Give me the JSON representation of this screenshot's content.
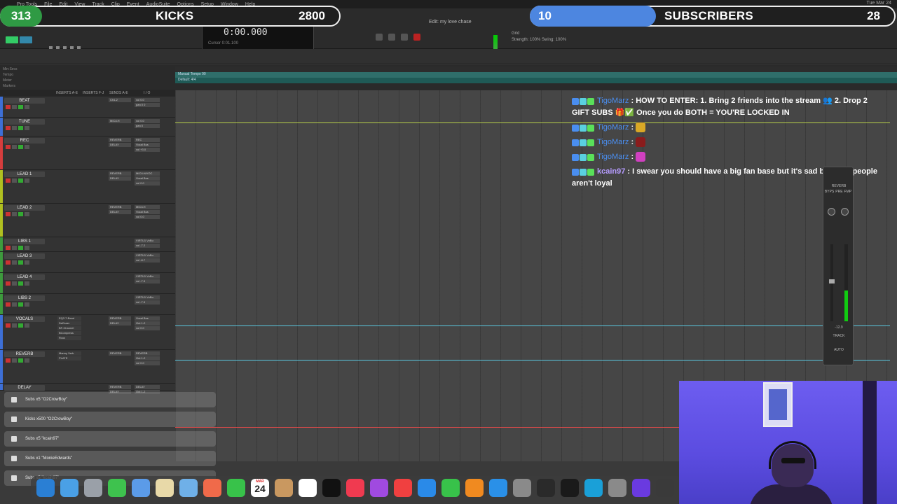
{
  "menubar": {
    "items": [
      "Pro Tools",
      "File",
      "Edit",
      "View",
      "Track",
      "Clip",
      "Event",
      "AudioSuite",
      "Options",
      "Setup",
      "Window",
      "Help"
    ],
    "clock": "Tue Mar 24"
  },
  "toolbar": {
    "counter_main": "0:00.000",
    "counter_sub": "Cursor  0:01.100",
    "edit_window_title": "Edit: my love chase",
    "grid_label": "Grid",
    "strength_label": "Strength: 100%  Swing: 100%"
  },
  "banners": {
    "kicks": {
      "count_left": "313",
      "label": "KICKS",
      "count_right": "2800"
    },
    "subs": {
      "count_left": "10",
      "label": "SUBSCRIBERS",
      "count_right": "28"
    }
  },
  "rulers": {
    "names": [
      "Min:Secs",
      "Tempo",
      "Meter",
      "Markers"
    ],
    "tempo_text": "Manual Tempo  90",
    "meter_text": "Default: 4/4"
  },
  "mix_header": {
    "inserts_ae": "INSERTS A-E",
    "inserts_fj": "INSERTS F-J",
    "sends_ae": "SENDS A-E",
    "io": "I / O"
  },
  "tracks": [
    {
      "name": "BEAT",
      "color": "#3d6fd6",
      "inserts": [
        "Ch1-2"
      ],
      "io": [
        "vol 0.0",
        "pan 0 0"
      ]
    },
    {
      "name": "TUNE",
      "color": "#3d6fd6",
      "inserts": [
        "MIC/LH"
      ],
      "io": [
        "vol 0.0",
        "pan 0"
      ]
    },
    {
      "name": "REC",
      "color": "#d63d3d",
      "inserts": [
        "REVERB",
        "DELAY"
      ],
      "io": [
        "REC",
        "Vocal Bus",
        "vol +3.0"
      ]
    },
    {
      "name": "LEAD 1",
      "color": "#b0c020",
      "inserts": [
        "REVERB",
        "DELAY"
      ],
      "io": [
        "MIC/LH/VOC",
        "Vocal Bus",
        "vol 0.0"
      ]
    },
    {
      "name": "LEAD 2",
      "color": "#b0c020",
      "inserts": [
        "REVERB",
        "DELAY"
      ],
      "io": [
        "MIC/LH",
        "Vocal Bus",
        "vol 0.0"
      ]
    },
    {
      "name": "LIBS 1",
      "color": "#3d9a3d",
      "inserts": [],
      "io": [
        "VIRTU1 VxBu",
        "vol -7.2"
      ]
    },
    {
      "name": "LEAD 3",
      "color": "#3d9a3d",
      "inserts": [],
      "io": [
        "VIRTU1 VxBu",
        "vol -8.7"
      ]
    },
    {
      "name": "LEAD 4",
      "color": "#3d9a3d",
      "inserts": [],
      "io": [
        "VIRTU1 VxBu",
        "vol -7.9"
      ]
    },
    {
      "name": "LIBS 2",
      "color": "#3d9a3d",
      "inserts": [],
      "io": [
        "VIRTU1 VxBu",
        "vol -7.9"
      ]
    },
    {
      "name": "VOCALS",
      "color": "#3d6fd6",
      "inserts": [
        "REVERB",
        "DELAY"
      ],
      "plugins": [
        "EQ3 7-Band",
        "DeEsser",
        "BF-Channel",
        "BCompress",
        "Rvox"
      ],
      "io": [
        "Vocal Bus",
        "Out 1-2",
        "vol 0.0"
      ]
    },
    {
      "name": "REVERB",
      "color": "#3d6fd6",
      "inserts": [
        "REVERB"
      ],
      "plugins": [
        "Manny Verb",
        "PLATE"
      ],
      "io": [
        "REVERB",
        "Out 1-2",
        "vol 0.0"
      ]
    },
    {
      "name": "DELAY",
      "color": "#3d6fd6",
      "inserts": [
        "REVERB",
        "DELAY"
      ],
      "io": [
        "DELAY",
        "Out 1-2"
      ]
    }
  ],
  "chat": [
    {
      "user": "TigoMarz",
      "user_style": "blue",
      "text": "HOW TO ENTER: 1. Bring 2 friends into the stream 👥 2. Drop 2 GIFT SUBS 🎁✅ Once you do BOTH = YOU'RE LOCKED IN",
      "emote": ""
    },
    {
      "user": "TigoMarz",
      "user_style": "blue",
      "text": "",
      "emote": "#d9a826"
    },
    {
      "user": "TigoMarz",
      "user_style": "blue",
      "text": "",
      "emote": "#8a1c1c"
    },
    {
      "user": "TigoMarz",
      "user_style": "blue",
      "text": "",
      "emote": "#d040c0"
    },
    {
      "user": "kcain97",
      "user_style": "purple",
      "text": "I swear you should have a big fan base but it's sad because people aren't loyal",
      "emote": ""
    }
  ],
  "plugin_window": {
    "title": "REVERB",
    "buttons": [
      "BYPS",
      "PRE",
      "FMP"
    ],
    "value": "-12.9",
    "track_label": "TRACK",
    "auto_label": "AUTO"
  },
  "toasts": [
    {
      "text": "Subs x5 \"O2CrowBoy\"",
      "icon": "gift-icon"
    },
    {
      "text": "Kicks x500 \"O2CrowBoy\"",
      "icon": "kick-icon"
    },
    {
      "text": "Subs x5 \"kcain97\"",
      "icon": "gift-icon"
    },
    {
      "text": "Subs x1 \"MonieEdwards\"",
      "icon": "gift-icon"
    },
    {
      "text": "Subs x5 \"kcain97\"",
      "icon": "gift-icon"
    }
  ],
  "dock": {
    "calendar_month": "MAR",
    "calendar_day": "24",
    "app_colors": [
      "#2a7fd4",
      "#4aa0e6",
      "#9aa0a8",
      "#3ec24e",
      "#5b9be8",
      "#e8d9a8",
      "#6fb0e8",
      "#f06a4a",
      "#38c24a",
      "#c99860",
      "#ffffff",
      "#111111",
      "#f03a50",
      "#a04ae0",
      "#f04040",
      "#2a8ae8",
      "#38c24a",
      "#f08a20",
      "#2a90e8",
      "#8a8a8a",
      "#2a2a2a",
      "#1a1a1a",
      "#1aa0d8",
      "#8a8a8a",
      "#6a3ae0",
      "#3a3a3a"
    ]
  },
  "colors": {
    "kicks_accent": "#2f9a44",
    "subs_accent": "#4d86e0",
    "chat_user_blue": "#4a8ef0",
    "chat_user_purple": "#b69cff"
  }
}
